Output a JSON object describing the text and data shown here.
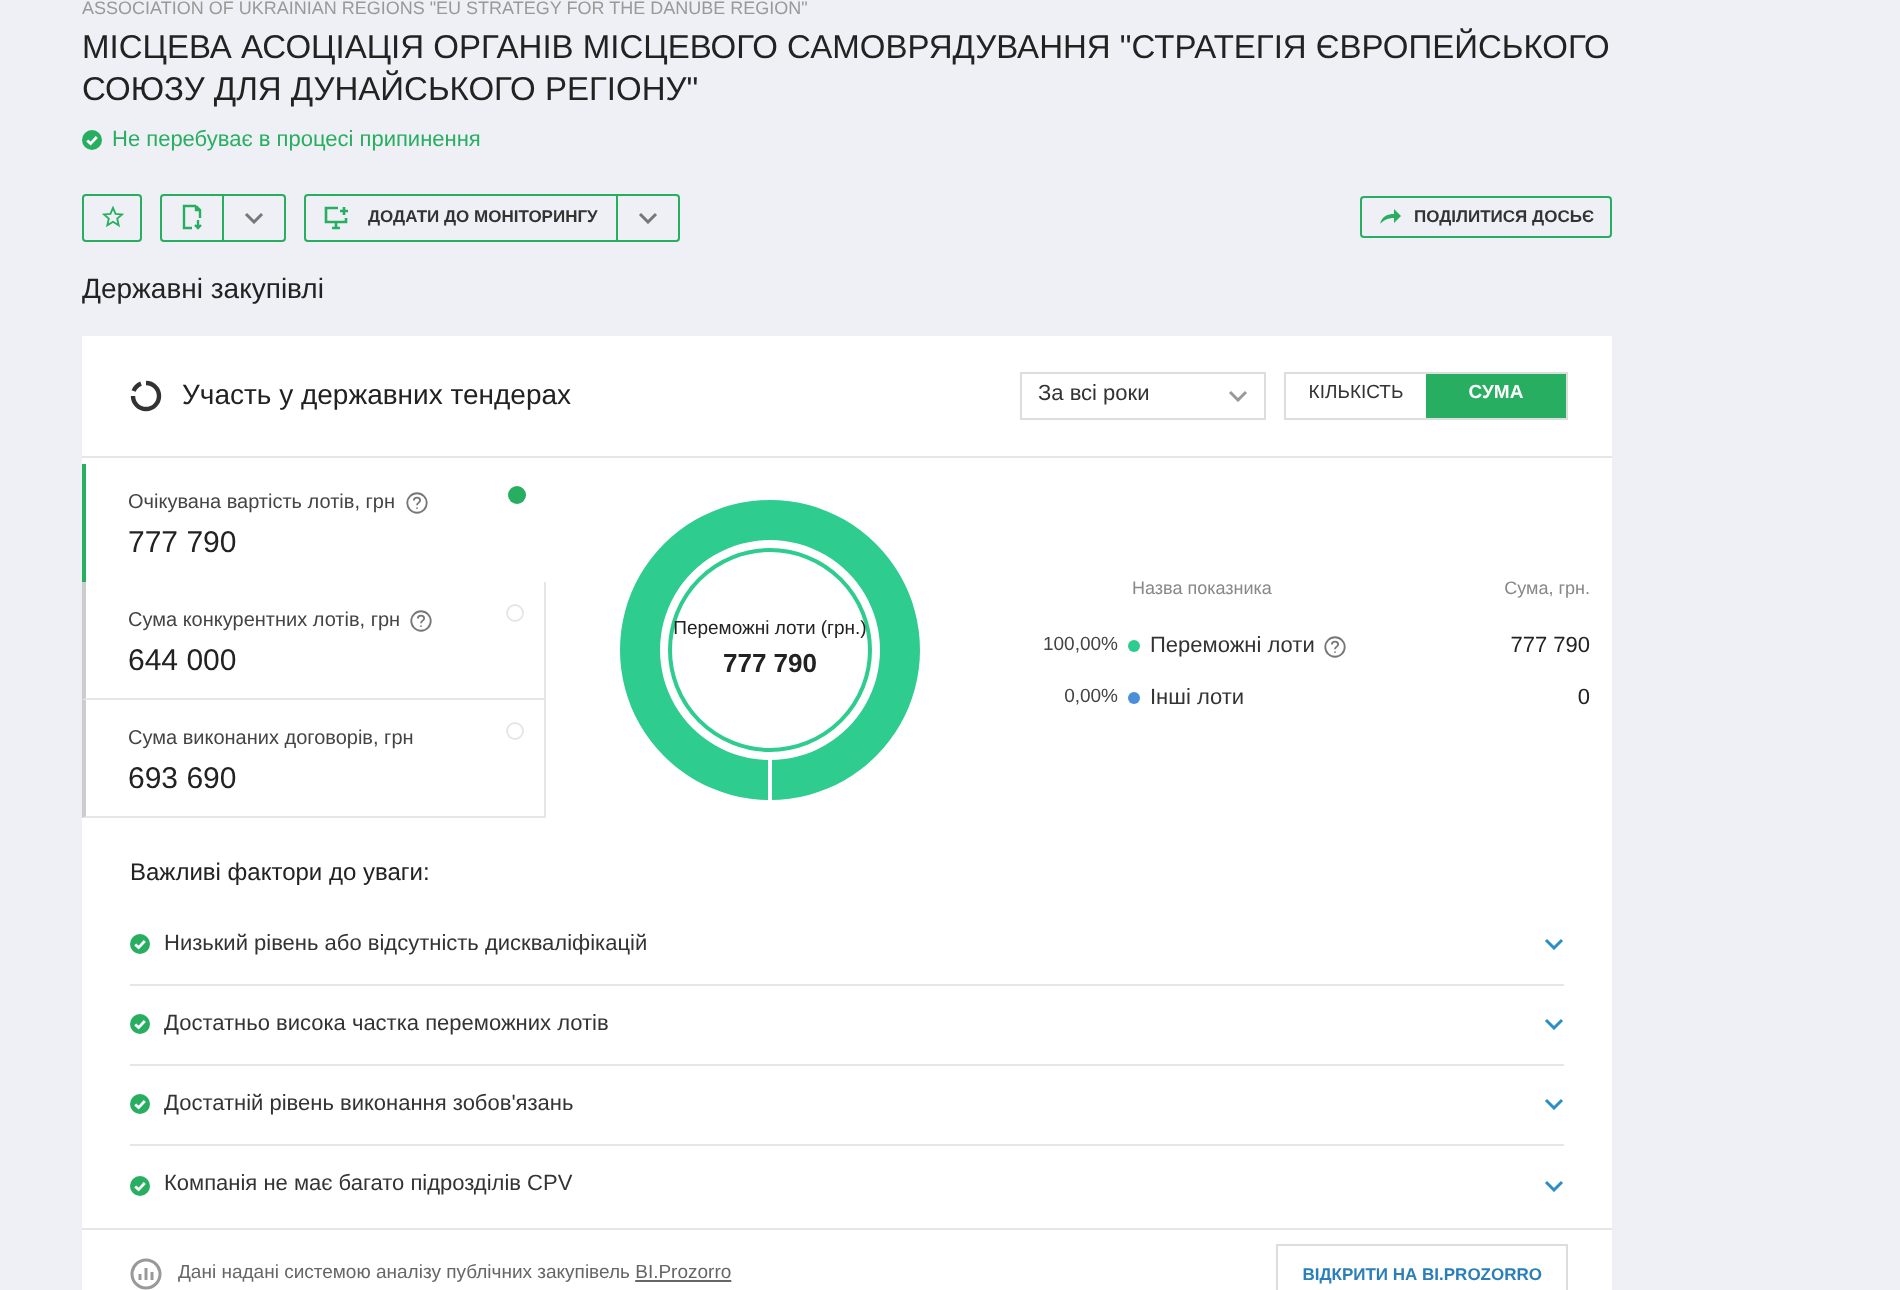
{
  "header": {
    "subtitle": "ASSOCIATION OF UKRAINIAN REGIONS \"EU STRATEGY FOR THE DANUBE REGION\"",
    "title": "МІСЦЕВА АСОЦІАЦІЯ ОРГАНІВ МІСЦЕВОГО САМОВРЯДУВАННЯ \"СТРАТЕГІЯ ЄВРОПЕЙСЬКОГО СОЮЗУ ДЛЯ ДУНАЙСЬКОГО РЕГІОНУ\"",
    "status": "Не перебуває в процесі припинення",
    "status_ok": true
  },
  "toolbar": {
    "monitor_button": "ДОДАТИ ДО МОНІТОРИНГУ",
    "share_button": "ПОДІЛИТИСЯ ДОСЬЄ"
  },
  "section_title": "Державні закупівлі",
  "card": {
    "title": "Участь у державних тендерах",
    "period_select": "За всі роки",
    "toggle": [
      {
        "label": "КІЛЬКІСТЬ",
        "selected": false
      },
      {
        "label": "СУМА",
        "selected": true
      }
    ],
    "metrics": [
      {
        "label": "Очікувана вартість лотів, грн",
        "value": "777 790",
        "help": true,
        "selected": true
      },
      {
        "label": "Сума конкурентних лотів, грн",
        "value": "644 000",
        "help": true,
        "selected": false
      },
      {
        "label": "Сума виконаних договорів, грн",
        "value": "693 690",
        "help": false,
        "selected": false
      }
    ],
    "donut": {
      "center_label": "Переможні лоти (грн.)",
      "center_value": "777 790"
    },
    "legend": {
      "column_name": "Назва показника",
      "column_sum": "Сума, грн.",
      "rows": [
        {
          "percent": "100,00%",
          "name": "Переможні лоти",
          "value": "777 790",
          "color": "#2ecc8f",
          "help": true
        },
        {
          "percent": "0,00%",
          "name": "Інші лоти",
          "value": "0",
          "color": "#4a90d9",
          "help": false
        }
      ]
    },
    "factors_title": "Важливі фактори до уваги:",
    "factors": [
      {
        "text": "Низький рівень або відсутність дискваліфікацій",
        "ok": true,
        "expanded": false
      },
      {
        "text": "Достатньо висока частка переможних лотів",
        "ok": true,
        "expanded": false
      },
      {
        "text": "Достатній рівень виконання зобов'язань",
        "ok": true,
        "expanded": false
      },
      {
        "text": "Компанія не має багато підрозділів CPV",
        "ok": true,
        "expanded": false
      }
    ],
    "footer": {
      "text": "Дані надані системою аналізу публічних закупівель",
      "link": "BI.Prozorro",
      "button": "ВІДКРИТИ НА BI.PROZORRO"
    }
  }
}
